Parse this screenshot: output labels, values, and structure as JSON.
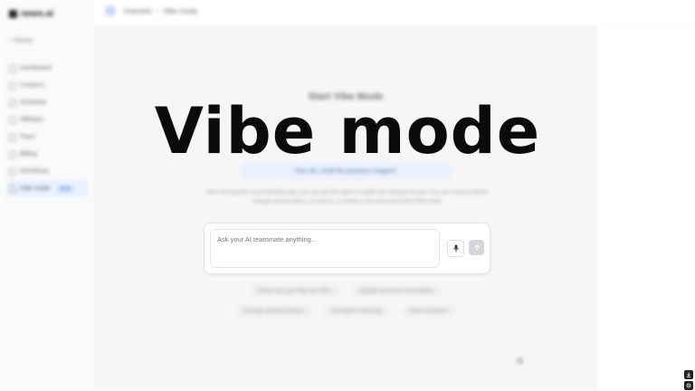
{
  "app": {
    "logo_text": "news.ai",
    "home_label": "Home",
    "nav_items": [
      {
        "label": "Dashboard"
      },
      {
        "label": "Creators"
      },
      {
        "label": "Schedule"
      },
      {
        "label": "Affiliates"
      },
      {
        "label": "Team"
      },
      {
        "label": "Billing"
      },
      {
        "label": "Workflows"
      },
      {
        "label": "Vibe mode",
        "active": true,
        "badge": "NEW"
      }
    ]
  },
  "topbar": {
    "breadcrumb_root": "channels",
    "breadcrumb_current": "Vibe mode"
  },
  "main": {
    "start_title": "Start Vibe Mode",
    "pill_text": "How do I draft the previous images?",
    "description": "After choosing the recommended plan, you can ask the agent to update the changes for you. You can create products, change conversations, or more to, or create a new post easily from Vibe mode.",
    "suggestions_row1": [
      "What can you help me with?",
      "Update business information"
    ],
    "suggestions_row2": [
      "Change guiding phrase",
      "Configure reporting",
      "Show business"
    ]
  },
  "chat": {
    "placeholder": "Ask your AI teammate anything..."
  },
  "overlay": {
    "title": "Vibe mode"
  },
  "colors": {
    "accent": "#3a6fd8",
    "send_button": "#d4d6db",
    "overlay_text": "#0b0b0b"
  },
  "icons": {
    "mic": "microphone-icon",
    "send": "send-icon",
    "download": "download-icon",
    "settings": "settings-icon"
  }
}
